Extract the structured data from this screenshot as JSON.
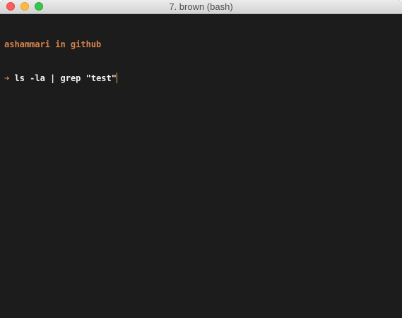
{
  "window": {
    "title": "7. brown (bash)"
  },
  "terminal": {
    "prompt_context": "ashammari in github",
    "prompt_arrow": "➜",
    "command": "ls -la | grep \"test\""
  },
  "colors": {
    "background": "#1c1c1c",
    "prompt": "#d9844c",
    "command": "#f2f2f2",
    "cursor": "#f2a83a"
  }
}
